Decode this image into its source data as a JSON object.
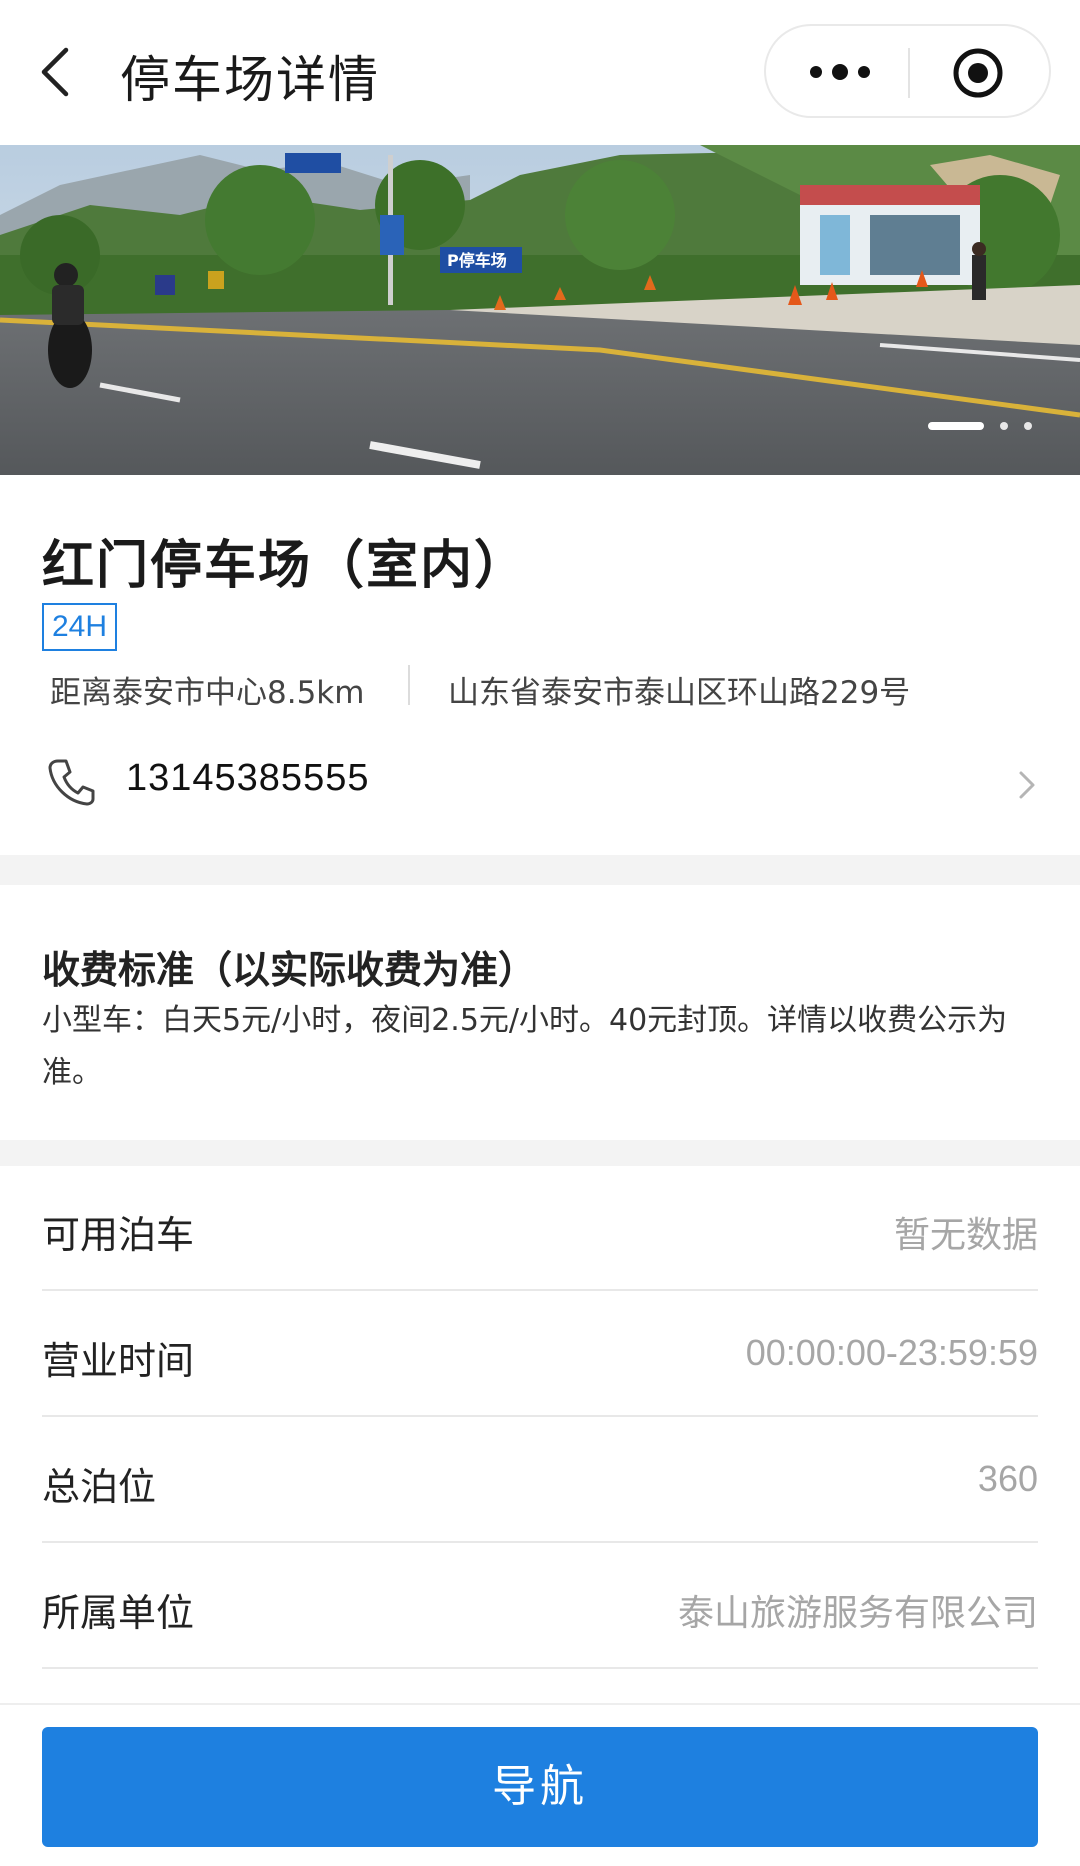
{
  "header": {
    "title": "停车场详情",
    "back_icon": "chevron-left-icon",
    "more_icon": "more-dots-icon",
    "close_icon": "target-icon"
  },
  "banner": {
    "image": "photo of parking lot entrance beside a mountain road",
    "sign_text": "P停车场",
    "slide_count": 3,
    "active_slide": 1
  },
  "lot": {
    "name": "红门停车场（室内）",
    "badge": "24H",
    "distance": "距离泰安市中心8.5km",
    "address": "山东省泰安市泰山区环山路229号",
    "phone": "13145385555",
    "phone_icon": "phone-icon"
  },
  "fee": {
    "title": "收费标准（以实际收费为准）",
    "description": "小型车：白天5元/小时，夜间2.5元/小时。40元封顶。详情以收费公示为准。"
  },
  "details": {
    "rows": [
      {
        "label": "可用泊车",
        "value": "暂无数据"
      },
      {
        "label": "营业时间",
        "value": "00:00:00-23:59:59"
      },
      {
        "label": "总泊位",
        "value": "360"
      },
      {
        "label": "所属单位",
        "value": "泰山旅游服务有限公司"
      }
    ]
  },
  "footer": {
    "nav_label": "导航"
  },
  "colors": {
    "accent": "#1e80e0",
    "section_gap": "#f3f3f3",
    "muted_text": "#a6a6a6"
  }
}
